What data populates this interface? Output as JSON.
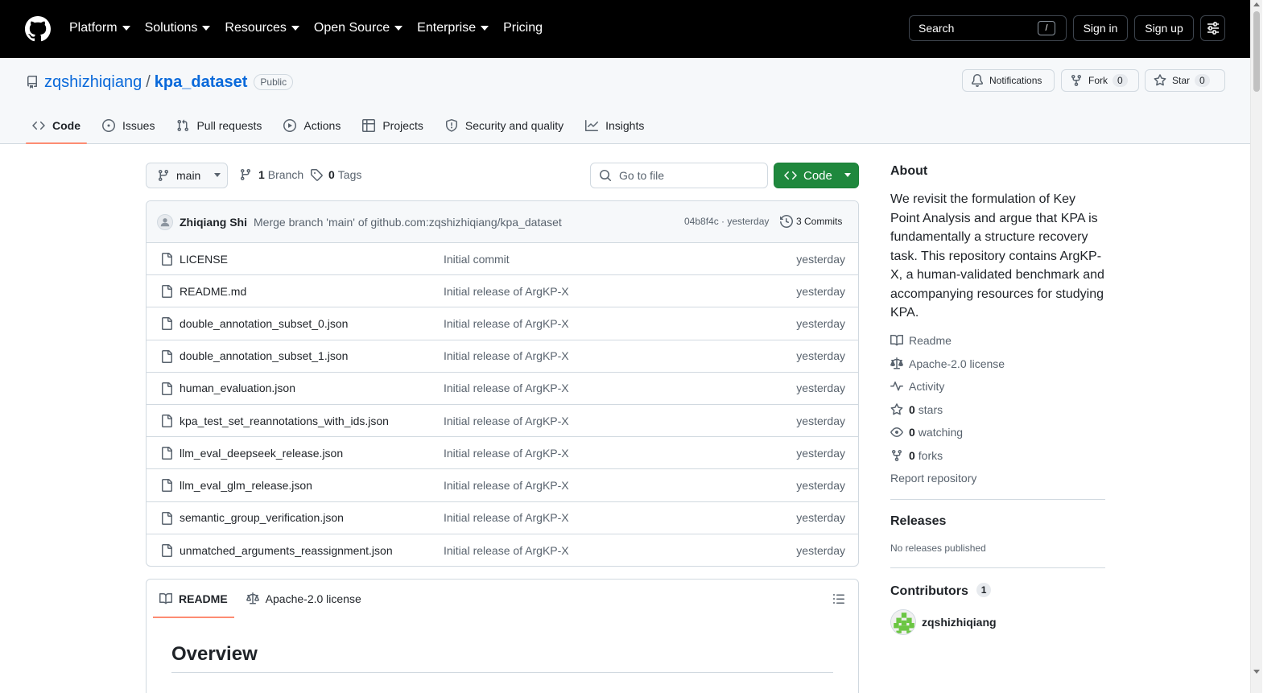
{
  "header": {
    "nav": [
      {
        "label": "Platform",
        "dropdown": true
      },
      {
        "label": "Solutions",
        "dropdown": true
      },
      {
        "label": "Resources",
        "dropdown": true
      },
      {
        "label": "Open Source",
        "dropdown": true
      },
      {
        "label": "Enterprise",
        "dropdown": true
      },
      {
        "label": "Pricing",
        "dropdown": false
      }
    ],
    "search_label": "Search",
    "search_shortcut": "/",
    "signin_label": "Sign in",
    "signup_label": "Sign up"
  },
  "repo": {
    "owner": "zqshizhiqiang",
    "separator": "/",
    "name": "kpa_dataset",
    "visibility": "Public",
    "notifications_label": "Notifications",
    "fork_label": "Fork",
    "fork_count": "0",
    "star_label": "Star",
    "star_count": "0",
    "tabs": [
      {
        "label": "Code",
        "icon": "code-icon",
        "active": true
      },
      {
        "label": "Issues",
        "icon": "issue-icon",
        "active": false
      },
      {
        "label": "Pull requests",
        "icon": "pull-request-icon",
        "active": false
      },
      {
        "label": "Actions",
        "icon": "play-icon",
        "active": false
      },
      {
        "label": "Projects",
        "icon": "table-icon",
        "active": false
      },
      {
        "label": "Security and quality",
        "icon": "shield-icon",
        "active": false
      },
      {
        "label": "Insights",
        "icon": "graph-icon",
        "active": false
      }
    ]
  },
  "branch_bar": {
    "branch": "main",
    "branch_count": "1",
    "branch_label": "Branch",
    "tag_count": "0",
    "tag_label": "Tags",
    "goto_placeholder": "Go to file",
    "code_label": "Code"
  },
  "latest_commit": {
    "author": "Zhiqiang Shi",
    "message": "Merge branch 'main' of github.com:zqshizhiqiang/kpa_dataset",
    "hash_time": "04b8f4c · yesterday",
    "commits_label": "3 Commits"
  },
  "files": [
    {
      "name": "LICENSE",
      "commit": "Initial commit",
      "time": "yesterday"
    },
    {
      "name": "README.md",
      "commit": "Initial release of ArgKP-X",
      "time": "yesterday"
    },
    {
      "name": "double_annotation_subset_0.json",
      "commit": "Initial release of ArgKP-X",
      "time": "yesterday"
    },
    {
      "name": "double_annotation_subset_1.json",
      "commit": "Initial release of ArgKP-X",
      "time": "yesterday"
    },
    {
      "name": "human_evaluation.json",
      "commit": "Initial release of ArgKP-X",
      "time": "yesterday"
    },
    {
      "name": "kpa_test_set_reannotations_with_ids.json",
      "commit": "Initial release of ArgKP-X",
      "time": "yesterday"
    },
    {
      "name": "llm_eval_deepseek_release.json",
      "commit": "Initial release of ArgKP-X",
      "time": "yesterday"
    },
    {
      "name": "llm_eval_glm_release.json",
      "commit": "Initial release of ArgKP-X",
      "time": "yesterday"
    },
    {
      "name": "semantic_group_verification.json",
      "commit": "Initial release of ArgKP-X",
      "time": "yesterday"
    },
    {
      "name": "unmatched_arguments_reassignment.json",
      "commit": "Initial release of ArgKP-X",
      "time": "yesterday"
    }
  ],
  "readme": {
    "tab_readme": "README",
    "tab_license": "Apache-2.0 license",
    "heading": "Overview"
  },
  "about": {
    "title": "About",
    "description": "We revisit the formulation of Key Point Analysis and argue that KPA is fundamentally a structure recovery task. This repository contains ArgKP-X, a human-validated benchmark and accompanying resources for studying KPA.",
    "readme": "Readme",
    "license": "Apache-2.0 license",
    "activity": "Activity",
    "stars_count": "0",
    "stars_label": "stars",
    "watching_count": "0",
    "watching_label": "watching",
    "forks_count": "0",
    "forks_label": "forks",
    "report": "Report repository"
  },
  "releases": {
    "title": "Releases",
    "empty": "No releases published"
  },
  "contributors": {
    "title": "Contributors",
    "count": "1",
    "list": [
      {
        "name": "zqshizhiqiang"
      }
    ]
  },
  "colors": {
    "accent": "#0969da",
    "primary_button": "#1f883d",
    "active_tab_underline": "#fd8c73",
    "header_bg": "#000000"
  }
}
